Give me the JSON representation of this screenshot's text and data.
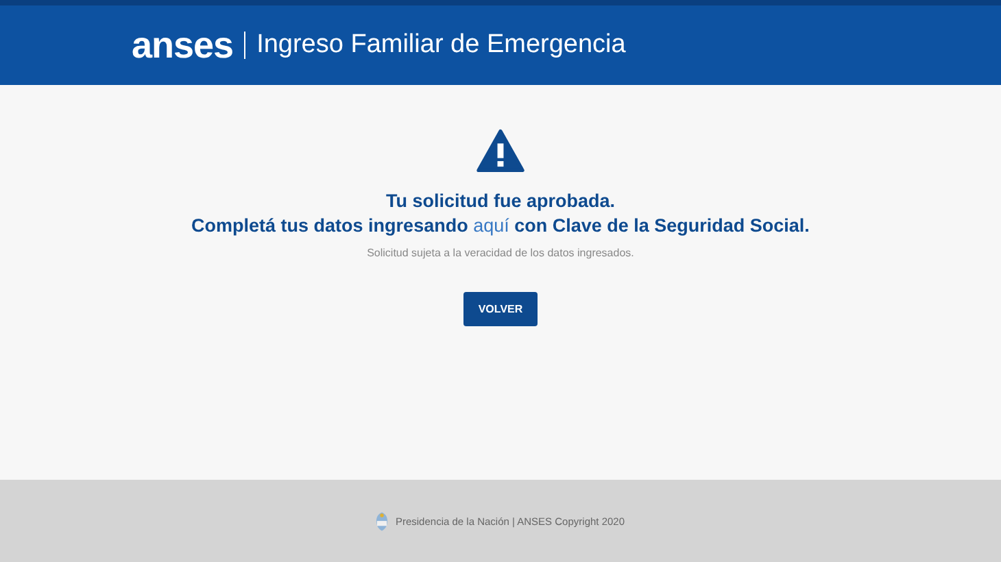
{
  "header": {
    "logo": "anses",
    "title": "Ingreso Familiar de Emergencia"
  },
  "message": {
    "heading": "Tu solicitud fue aprobada.",
    "line": {
      "before": "Completá tus datos ingresando ",
      "link": "aquí",
      "after": " con Clave de la Seguridad Social."
    },
    "note": "Solicitud sujeta a la veracidad de los datos ingresados."
  },
  "button": "VOLVER",
  "footer": "Presidencia de la Nación | ANSES Copyright 2020"
}
